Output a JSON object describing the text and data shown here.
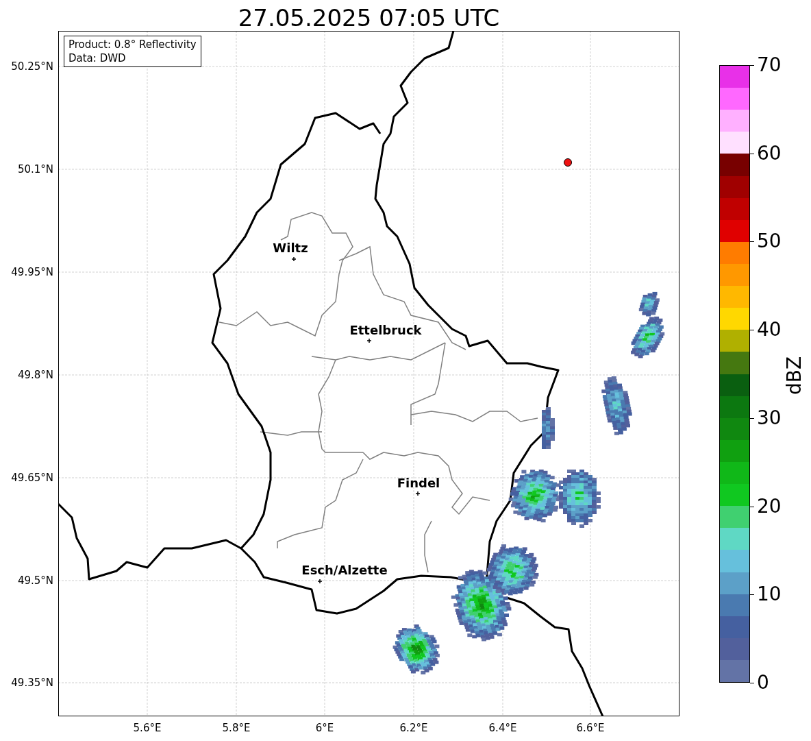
{
  "title": "27.05.2025 07:05 UTC",
  "info_box": [
    "Product: 0.8° Reflectivity",
    "Data: DWD"
  ],
  "map": {
    "cities": [
      "Wiltz",
      "Ettelbruck",
      "Findel",
      "Esch/Alzette"
    ],
    "x_ticks": [
      "5.6°E",
      "5.8°E",
      "6°E",
      "6.2°E",
      "6.4°E",
      "6.6°E"
    ],
    "y_ticks": [
      "50.25°N",
      "50.1°N",
      "49.95°N",
      "49.8°N",
      "49.65°N",
      "49.5°N",
      "49.35°N"
    ]
  },
  "colorbar": {
    "label": "dBZ",
    "ticks": [
      "70",
      "60",
      "50",
      "40",
      "30",
      "20",
      "10",
      "0"
    ],
    "bands": [
      {
        "color": "#e830e8"
      },
      {
        "color": "#ff68ff"
      },
      {
        "color": "#ffb0ff"
      },
      {
        "color": "#ffe0ff"
      },
      {
        "color": "#780000"
      },
      {
        "color": "#a00000"
      },
      {
        "color": "#c00000"
      },
      {
        "color": "#e00000"
      },
      {
        "color": "#ff7c00"
      },
      {
        "color": "#ff9800"
      },
      {
        "color": "#ffb800"
      },
      {
        "color": "#ffd800"
      },
      {
        "color": "#b0b000"
      },
      {
        "color": "#457810"
      },
      {
        "color": "#0a5f10"
      },
      {
        "color": "#0c7810"
      },
      {
        "color": "#108810"
      },
      {
        "color": "#10a010"
      },
      {
        "color": "#10b818"
      },
      {
        "color": "#10c820"
      },
      {
        "color": "#40d070"
      },
      {
        "color": "#5fd8c4"
      },
      {
        "color": "#66c0dc"
      },
      {
        "color": "#5ca0c8"
      },
      {
        "color": "#4a7ab0"
      },
      {
        "color": "#4560a0"
      },
      {
        "color": "#52609c"
      },
      {
        "color": "#6373a6"
      }
    ]
  }
}
